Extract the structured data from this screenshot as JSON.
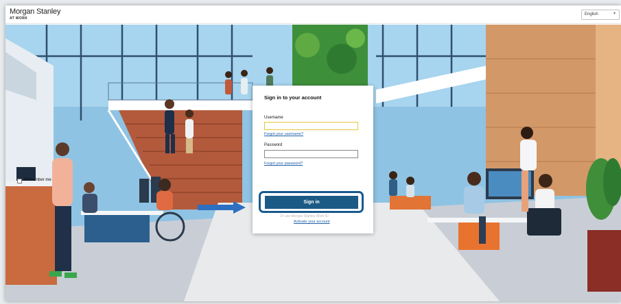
{
  "brand": {
    "name": "Morgan Stanley",
    "tagline": "AT WORK"
  },
  "language": {
    "selected": "English",
    "chevron_icon": "chevron-down-icon"
  },
  "signin": {
    "title": "Sign in to your account",
    "username_label": "Username",
    "username_value": "",
    "forgot_username": "Forgot your username?",
    "password_label": "Password",
    "password_value": "",
    "forgot_password": "Forgot your password?",
    "remember_label": "Remember me",
    "submit_label": "Sign in",
    "faint_text": "Or use Morgan Stanley Work ID",
    "activate_link": "Activate your account"
  },
  "annotation": {
    "highlight_color": "#16598e",
    "arrow_color": "#2d6fc0"
  }
}
